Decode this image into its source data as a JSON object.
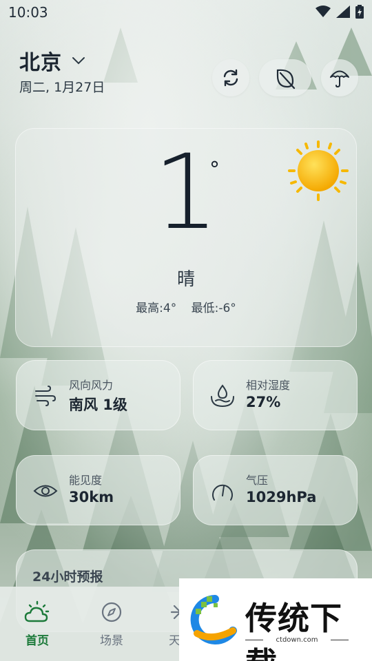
{
  "status_bar": {
    "time": "10:03"
  },
  "header": {
    "city": "北京",
    "date": "周二, 1月27日"
  },
  "current": {
    "temperature": "1",
    "degree_symbol": "°",
    "condition": "晴",
    "high": "最高:4°",
    "low": "最低:-6°",
    "icon": "sun-icon"
  },
  "details": {
    "wind": {
      "label": "风向风力",
      "value": "南风 1级",
      "icon": "wind-icon"
    },
    "humidity": {
      "label": "相对湿度",
      "value": "27%",
      "icon": "humidity-icon"
    },
    "visibility": {
      "label": "能见度",
      "value": "30km",
      "icon": "eye-icon"
    },
    "pressure": {
      "label": "气压",
      "value": "1029hPa",
      "icon": "gauge-icon"
    }
  },
  "forecast": {
    "title": "24小时预报"
  },
  "nav": {
    "home": "首页",
    "scene": "场景",
    "astro": "天文"
  },
  "watermark": {
    "text": "传统下载",
    "url": "ctdown.com"
  },
  "colors": {
    "accent": "#1c7a3a",
    "text": "#1f2a36",
    "sun": "#f6b800"
  }
}
